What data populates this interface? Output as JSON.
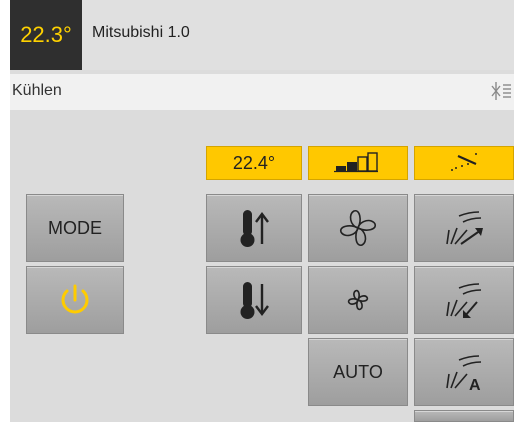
{
  "header": {
    "temperature": "22.3°",
    "device_name": "Mitsubishi 1.0"
  },
  "mode": {
    "label": "Kühlen",
    "icon": "snowflake-icon"
  },
  "status": {
    "setpoint": "22.4°",
    "fan_speed_icon": "fan-level-bars-icon",
    "swing_icon": "vane-position-icon"
  },
  "buttons": {
    "mode": "MODE",
    "power_icon": "power-icon",
    "temp_up_icon": "thermometer-up-icon",
    "temp_down_icon": "thermometer-down-icon",
    "fan_up_icon": "fan-large-icon",
    "fan_down_icon": "fan-small-icon",
    "fan_auto": "AUTO",
    "vane_up_icon": "vane-up-icon",
    "vane_down_icon": "vane-down-icon",
    "vane_auto_icon": "vane-auto-icon",
    "vane_auto_letter": "A"
  },
  "colors": {
    "accent": "#ffc800",
    "header_dark": "#2f2f2f",
    "temperature_text": "#ffd200",
    "power_icon": "#ffcc00"
  }
}
